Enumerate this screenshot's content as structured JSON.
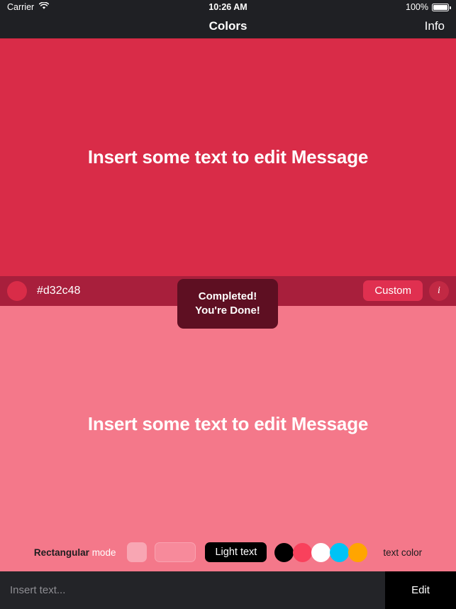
{
  "statusbar": {
    "carrier": "Carrier",
    "wifi_icon": "wifi-icon",
    "time": "10:26 AM",
    "battery_percent": "100%",
    "battery_icon": "battery-full-icon"
  },
  "navbar": {
    "title": "Colors",
    "right_action": "Info"
  },
  "top_panel": {
    "background": "#d92c48",
    "preview_text": "Insert some text to edit Message"
  },
  "toast": {
    "line1": "Completed!",
    "line2": "You're Done!",
    "background": "#5e0f22"
  },
  "colorbar": {
    "background": "#a81f3c",
    "swatch_color": "#d92c48",
    "hex_value": "#d32c48",
    "custom_label": "Custom",
    "info_label": "i"
  },
  "bottom_panel": {
    "background": "#f4788a",
    "preview_text": "Insert some text to edit Message"
  },
  "options": {
    "mode_strong": "Rectangular",
    "mode_soft": "mode",
    "shape_small_color": "#f8a6b3",
    "shape_large_color": "#f78a9b",
    "light_text_label": "Light text",
    "text_color_label": "text color",
    "text_colors": [
      {
        "name": "black",
        "hex": "#000000"
      },
      {
        "name": "red",
        "hex": "#f9415c"
      },
      {
        "name": "white",
        "hex": "#ffffff"
      },
      {
        "name": "cyan",
        "hex": "#00c3f5"
      },
      {
        "name": "orange",
        "hex": "#ffa500"
      }
    ]
  },
  "inputbar": {
    "placeholder": "Insert text...",
    "value": "",
    "edit_label": "Edit"
  }
}
